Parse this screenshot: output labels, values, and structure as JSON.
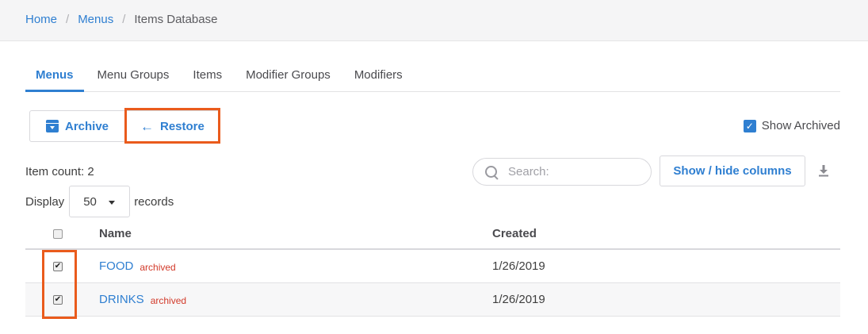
{
  "breadcrumb": {
    "home": "Home",
    "menus": "Menus",
    "current": "Items Database",
    "separator": "/"
  },
  "tabs": [
    {
      "label": "Menus",
      "active": true
    },
    {
      "label": "Menu Groups",
      "active": false
    },
    {
      "label": "Items",
      "active": false
    },
    {
      "label": "Modifier Groups",
      "active": false
    },
    {
      "label": "Modifiers",
      "active": false
    }
  ],
  "toolbar": {
    "archive_label": "Archive",
    "archive_icon": "archive-box-icon",
    "restore_label": "Restore",
    "restore_icon": "arrow-left-icon",
    "show_archived_label": "Show Archived",
    "show_archived_checked": true
  },
  "item_count": "Item count: 2",
  "search": {
    "placeholder": "Search:",
    "value": ""
  },
  "columns_button_label": "Show / hide columns",
  "download_icon": "download-icon",
  "display": {
    "prefix": "Display",
    "value": "50",
    "suffix": "records"
  },
  "table": {
    "headers": {
      "name": "Name",
      "created": "Created"
    },
    "rows": [
      {
        "name": "FOOD",
        "tag": "archived",
        "created": "1/26/2019",
        "checked": true
      },
      {
        "name": "DRINKS",
        "tag": "archived",
        "created": "1/26/2019",
        "checked": true
      }
    ]
  },
  "colors": {
    "accent": "#2f7fd1",
    "highlight": "#ea5b1c",
    "archived_tag": "#d23a2a"
  }
}
